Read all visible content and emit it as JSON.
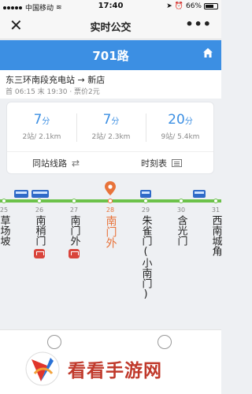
{
  "status_bar": {
    "carrier": "中国移动",
    "time": "17:40",
    "battery": "66%"
  },
  "nav": {
    "title": "实时公交",
    "close_icon": "close-icon",
    "more_icon": "more-icon"
  },
  "route": {
    "name": "701路",
    "direction": "东三环南段充电站 → 新店",
    "schedule": "首 06:15 末 19:30 · 票价2元"
  },
  "arrivals": [
    {
      "minutes": "7",
      "unit": "分",
      "meta": "2站/ 2.1km"
    },
    {
      "minutes": "7",
      "unit": "分",
      "meta": "2站/ 2.3km"
    },
    {
      "minutes": "20",
      "unit": "分",
      "meta": "9站/ 5.4km"
    }
  ],
  "actions": {
    "same_station": "同站线路",
    "timetable": "时刻表"
  },
  "stops": [
    {
      "num": "25",
      "name": "草场坡",
      "metro": false
    },
    {
      "num": "26",
      "name": "南稍门",
      "metro": true
    },
    {
      "num": "27",
      "name": "南门外",
      "metro": true
    },
    {
      "num": "28",
      "name": "南门外",
      "metro": false,
      "current": true
    },
    {
      "num": "29",
      "name": "朱雀门(小南门)",
      "metro": false
    },
    {
      "num": "30",
      "name": "含光门",
      "metro": false
    },
    {
      "num": "31",
      "name": "西南城角",
      "metro": false
    }
  ],
  "watermark": "看看手游网",
  "colors": {
    "accent": "#3c8fe3",
    "current": "#e8733a",
    "track": "#6cc24a",
    "metro": "#d9443b"
  }
}
